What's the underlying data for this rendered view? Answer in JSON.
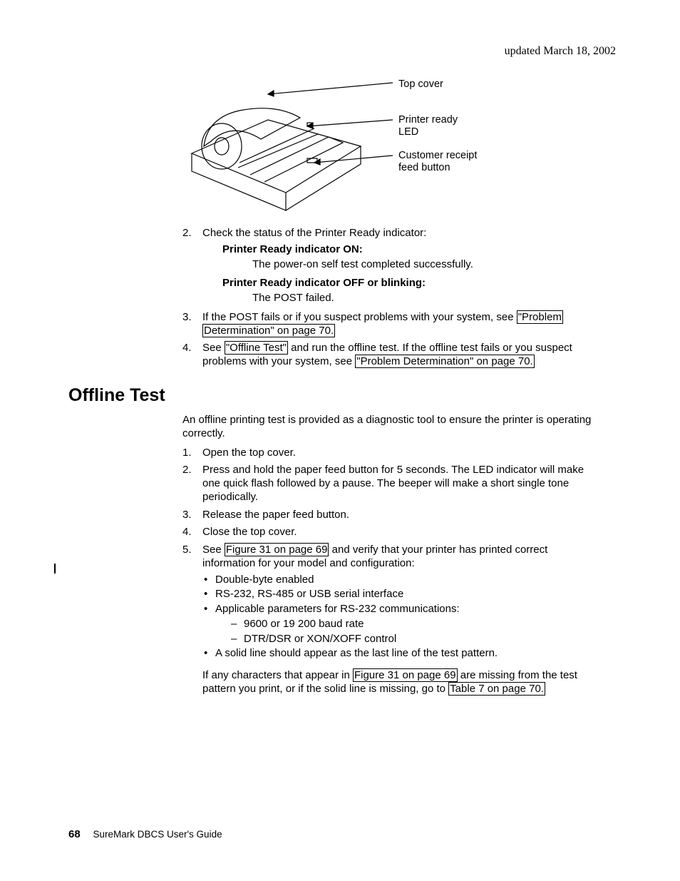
{
  "header": {
    "updated": "updated March 18, 2002"
  },
  "figure": {
    "label_top_cover": "Top cover",
    "label_led": "Printer ready\nLED",
    "label_feed_button": "Customer receipt\nfeed button"
  },
  "body": {
    "ol_top": [
      {
        "marker": "2.",
        "text": "Check the status of the Printer Ready indicator:"
      },
      {
        "marker": "3.",
        "text_a": "If the POST fails or if you suspect problems with your system, see ",
        "link1": "\"Problem",
        "link2": "Determination\" on page 70.",
        "text_b": ""
      },
      {
        "marker": "4.",
        "text_a": "See ",
        "link1": "\"Offline Test\"",
        "text_b": " and run the offline test. If the offline test fails or you suspect problems with your system, see ",
        "link2": "\"Problem Determination\" on page 70."
      }
    ],
    "dl": [
      {
        "dt": "Printer Ready indicator ON:",
        "dd": "The power-on self test completed successfully."
      },
      {
        "dt": "Printer Ready indicator OFF or blinking:",
        "dd": "The POST failed."
      }
    ],
    "heading": "Offline Test",
    "intro": "An offline printing test is provided as a diagnostic tool to ensure the printer is operating correctly.",
    "ol_offline": [
      {
        "marker": "1.",
        "text": "Open the top cover."
      },
      {
        "marker": "2.",
        "text": "Press and hold the paper feed button for 5 seconds. The LED indicator will make one quick flash followed by a pause. The beeper will make a short single tone periodically."
      },
      {
        "marker": "3.",
        "text": "Release the paper feed button."
      },
      {
        "marker": "4.",
        "text": "Close the top cover."
      },
      {
        "marker": "5.",
        "text_a": "See ",
        "link1": "Figure 31 on page 69",
        "text_b": " and verify that your printer has printed correct information for your model and configuration:"
      }
    ],
    "ul_config": [
      "Double-byte enabled",
      "RS-232, RS-485 or USB serial interface",
      "Applicable parameters for RS-232 communications:",
      "A solid line should appear as the last line of the test pattern."
    ],
    "ul_rs232": [
      "9600 or 19 200 baud rate",
      "DTR/DSR or XON/XOFF control"
    ],
    "closing": {
      "text_a": "If any characters that appear in ",
      "link1": "Figure 31 on page 69",
      "text_b": " are missing from the test pattern you print, or if the solid line is missing, go to ",
      "link2": "Table 7 on page 70."
    }
  },
  "footer": {
    "pageno": "68",
    "title": "SureMark DBCS User's Guide"
  }
}
